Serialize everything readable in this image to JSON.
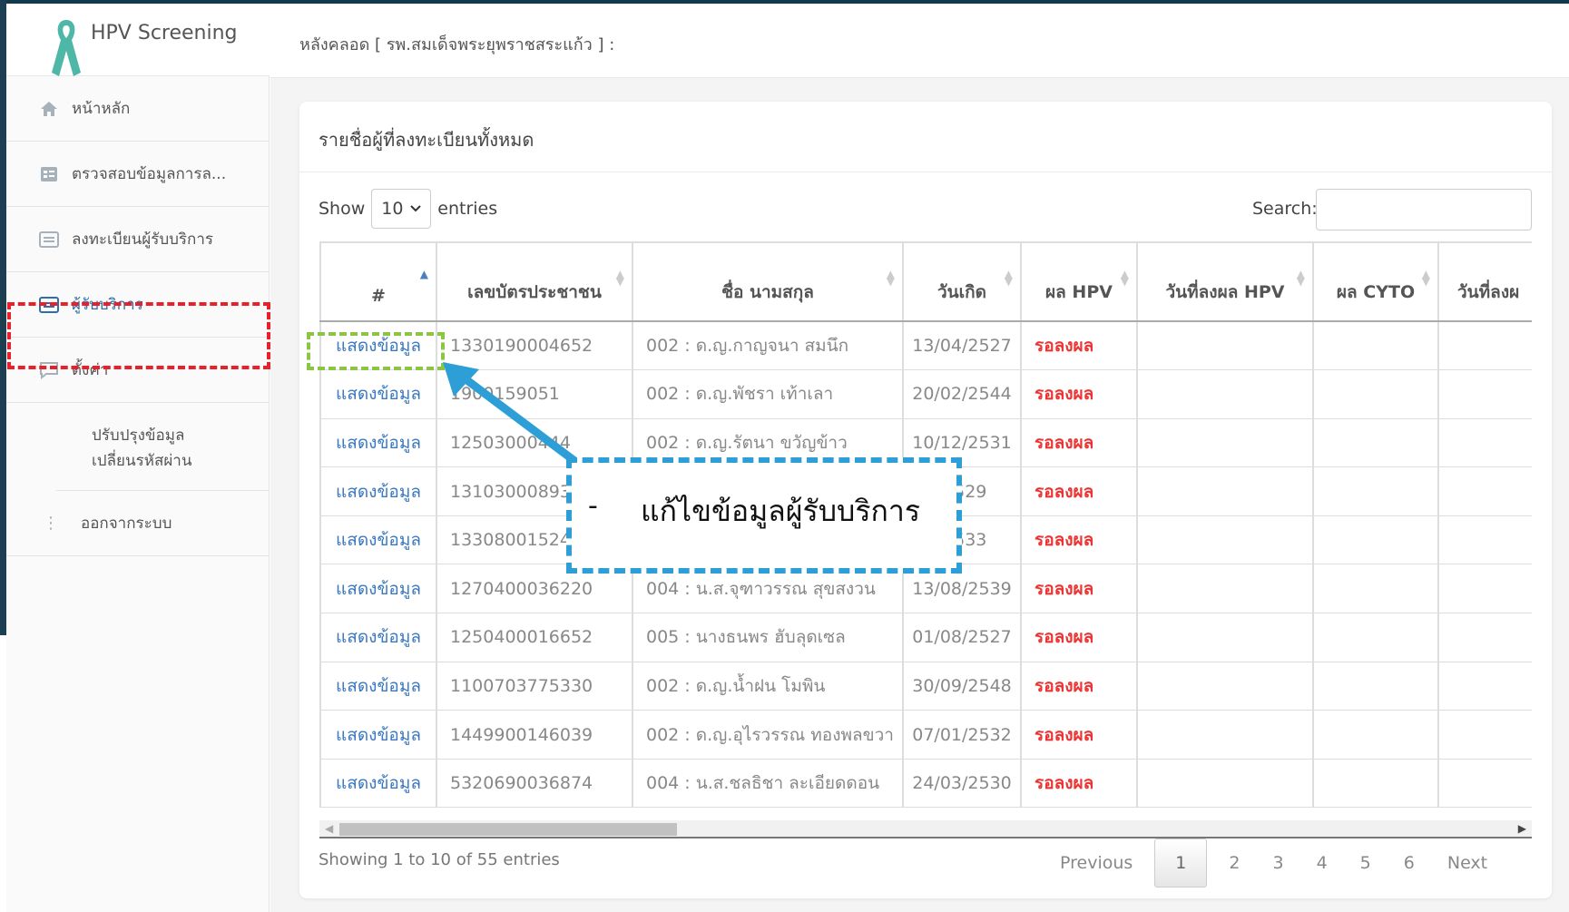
{
  "app": {
    "title": "HPV Screening"
  },
  "header": {
    "breadcrumb": "หลังคลอด [ รพ.สมเด็จพระยุพราชสระแก้ว ] :"
  },
  "sidebar": {
    "items": [
      {
        "label": "หน้าหลัก",
        "icon": "home-icon"
      },
      {
        "label": "ตรวจสอบข้อมูลการล...",
        "icon": "form-icon"
      },
      {
        "label": "ลงทะเบียนผู้รับบริการ",
        "icon": "list-icon"
      },
      {
        "label": "ผู้รับบริการ",
        "icon": "list-icon"
      },
      {
        "label": "ตั้งค่า",
        "icon": "chat-icon"
      }
    ],
    "sub": {
      "line1": "ปรับปรุงข้อมูล",
      "line2": "เปลี่ยนรหัสผ่าน"
    },
    "logout": "ออกจากระบบ"
  },
  "card": {
    "title": "รายชื่อผู้ที่ลงทะเบียนทั้งหมด",
    "show_label": "Show",
    "entries_value": "10",
    "entries_label": "entries",
    "search_label": "Search:",
    "search_value": ""
  },
  "table": {
    "columns": [
      "#",
      "เลขบัตรประชาชน",
      "ชื่อ นามสกุล",
      "วันเกิด",
      "ผล HPV",
      "วันที่ลงผล HPV",
      "ผล CYTO",
      "วันที่ลงผ"
    ],
    "rows": [
      {
        "action": "แสดงข้อมูล",
        "id": "1330190004652",
        "name": "002 : ด.ญ.กาญจนา สมนึก",
        "dob": "13/04/2527",
        "hpv": "รอลงผล"
      },
      {
        "action": "แสดงข้อมูล",
        "id": "1​900159051",
        "name": "002 : ด.ญ.พัชรา เท้าเลา",
        "dob": "20/02/2544",
        "hpv": "รอลงผล"
      },
      {
        "action": "แสดงข้อมูล",
        "id": "125030004​44",
        "name": "002 : ด.ญ.รัตนา ขวัญข้าว",
        "dob": "10/12/2531",
        "hpv": "รอลงผล"
      },
      {
        "action": "แสดงข้อมูล",
        "id": "131030008930",
        "name": "",
        "dob": "/2529",
        "hpv": "รอลงผล"
      },
      {
        "action": "แสดงข้อมูล",
        "id": "133080015242",
        "name": "",
        "dob": "/2533",
        "hpv": "รอลงผล"
      },
      {
        "action": "แสดงข้อมูล",
        "id": "1270400036220",
        "name": "004 : น.ส.จุฑาวรรณ สุขสงวน",
        "dob": "13/08/2539",
        "hpv": "รอลงผล"
      },
      {
        "action": "แสดงข้อมูล",
        "id": "1250400016652",
        "name": "005 : นางธนพร ฮับลุดเซล",
        "dob": "01/08/2527",
        "hpv": "รอลงผล"
      },
      {
        "action": "แสดงข้อมูล",
        "id": "1100703775330",
        "name": "002 : ด.ญ.น้ำฝน โมพิน",
        "dob": "30/09/2548",
        "hpv": "รอลงผล"
      },
      {
        "action": "แสดงข้อมูล",
        "id": "1449900146039",
        "name": "002 : ด.ญ.อุไรวรรณ ทองพลขวา",
        "dob": "07/01/2532",
        "hpv": "รอลงผล"
      },
      {
        "action": "แสดงข้อมูล",
        "id": "5320690036874",
        "name": "004 : น.ส.ชลธิชา ละเอียดดอน",
        "dob": "24/03/2530",
        "hpv": "รอลงผล"
      }
    ]
  },
  "footer": {
    "info": "Showing 1 to 10 of 55 entries",
    "previous": "Previous",
    "pages": [
      "1",
      "2",
      "3",
      "4",
      "5",
      "6"
    ],
    "next": "Next"
  },
  "annotation": {
    "dash": "-",
    "text": "แก้ไขข้อมูลผู้รับบริการ"
  },
  "colors": {
    "link": "#3a78c0",
    "status": "#e33333",
    "red_highlight": "#e8202a",
    "green_highlight": "#8ac641",
    "blue_callout": "#2e9fd6"
  }
}
